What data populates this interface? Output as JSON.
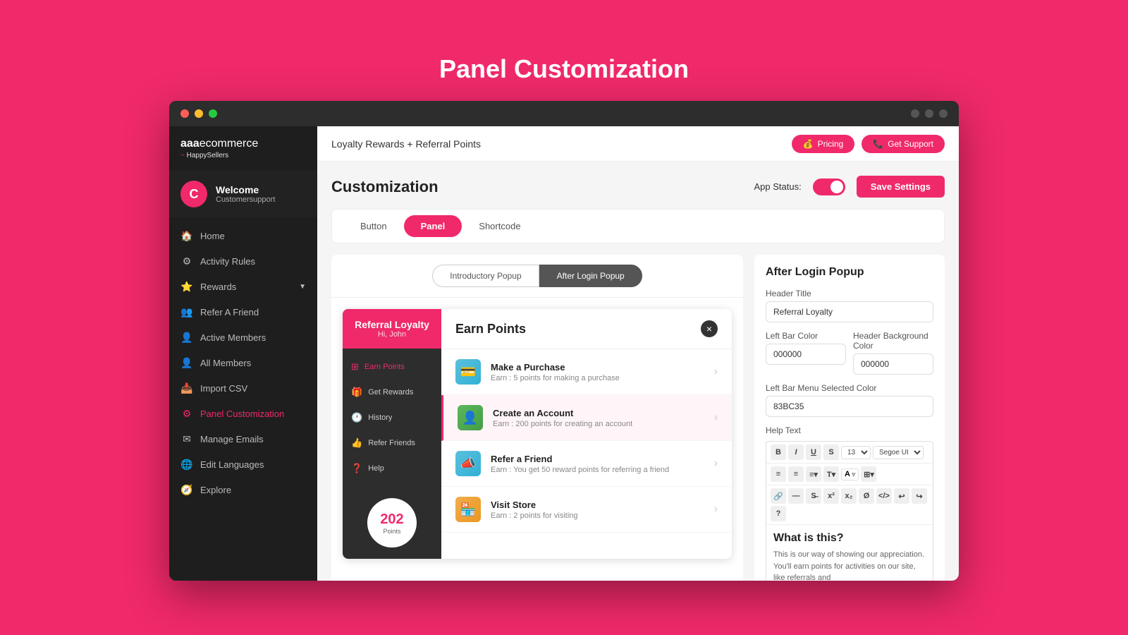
{
  "page": {
    "title": "Panel Customization"
  },
  "browser": {
    "dots_right": [
      "●",
      "●",
      "●"
    ]
  },
  "sidebar": {
    "logo": "aaaecommerce",
    "logo_sub": "HappySellers",
    "user": {
      "initial": "C",
      "welcome": "Welcome",
      "name": "Customersupport"
    },
    "nav_items": [
      {
        "label": "Home",
        "icon": "🏠",
        "active": false
      },
      {
        "label": "Activity Rules",
        "icon": "⚙",
        "active": false
      },
      {
        "label": "Rewards",
        "icon": "⭐",
        "active": false,
        "has_chevron": true
      },
      {
        "label": "Refer A Friend",
        "icon": "👥",
        "active": false
      },
      {
        "label": "Active Members",
        "icon": "👤",
        "active": false
      },
      {
        "label": "All Members",
        "icon": "👤",
        "active": false
      },
      {
        "label": "Import CSV",
        "icon": "📥",
        "active": false
      },
      {
        "label": "Panel Customization",
        "icon": "⚙",
        "active": true
      },
      {
        "label": "Manage Emails",
        "icon": "✉",
        "active": false
      },
      {
        "label": "Edit Languages",
        "icon": "🌐",
        "active": false
      },
      {
        "label": "Explore",
        "icon": "🧭",
        "active": false
      }
    ]
  },
  "topbar": {
    "title": "Loyalty Rewards + Referral Points",
    "pricing_btn": "Pricing",
    "support_btn": "Get Support"
  },
  "customization": {
    "title": "Customization",
    "app_status_label": "App Status:",
    "save_btn": "Save Settings",
    "tabs": [
      {
        "label": "Button",
        "active": false
      },
      {
        "label": "Panel",
        "active": true
      },
      {
        "label": "Shortcode",
        "active": false
      }
    ]
  },
  "popup_toggles": {
    "intro": "Introductory Popup",
    "after_login": "After Login Popup"
  },
  "referral_panel": {
    "title": "Referral Loyalty",
    "subtitle": "Hi, John",
    "nav_items": [
      {
        "label": "Earn Points",
        "icon": "⊞",
        "active": true
      },
      {
        "label": "Get Rewards",
        "icon": "🎁",
        "active": false
      },
      {
        "label": "History",
        "icon": "🕐",
        "active": false
      },
      {
        "label": "Refer Friends",
        "icon": "👍",
        "active": false
      },
      {
        "label": "Help",
        "icon": "❓",
        "active": false
      }
    ],
    "points": "202",
    "points_label": "Points"
  },
  "earn_panel": {
    "title": "Earn Points",
    "close": "×",
    "items": [
      {
        "name": "Make a Purchase",
        "desc": "Earn : 5 points for making a purchase",
        "icon": "💳",
        "icon_color": "blue",
        "selected": false
      },
      {
        "name": "Create an Account",
        "desc": "Earn : 200 points for creating an account",
        "icon": "👤",
        "icon_color": "green",
        "selected": true
      },
      {
        "name": "Refer a Friend",
        "desc": "Earn : You get 50 reward points for referring a friend",
        "icon": "📣",
        "icon_color": "blue",
        "selected": false
      },
      {
        "name": "Visit Store",
        "desc": "Earn : 2 points for visiting",
        "icon": "🏪",
        "icon_color": "orange",
        "selected": false
      }
    ]
  },
  "config": {
    "title": "After Login Popup",
    "header_title_label": "Header Title",
    "header_title_value": "Referral Loyalty",
    "left_bar_color_label": "Left Bar Color",
    "left_bar_color_value": "000000",
    "header_bg_color_label": "Header Background Color",
    "header_bg_color_value": "000000",
    "left_bar_menu_label": "Left Bar Menu Selected Color",
    "left_bar_menu_value": "83BC35",
    "help_text_label": "Help Text",
    "editor_heading": "What is this?",
    "editor_body": "This is our way of showing our appreciation. You'll earn points for activities on our site, like referrals and",
    "toolbar_buttons": [
      "B",
      "I",
      "U",
      "S"
    ],
    "font_size": "13",
    "font_family": "Segoe UI"
  }
}
